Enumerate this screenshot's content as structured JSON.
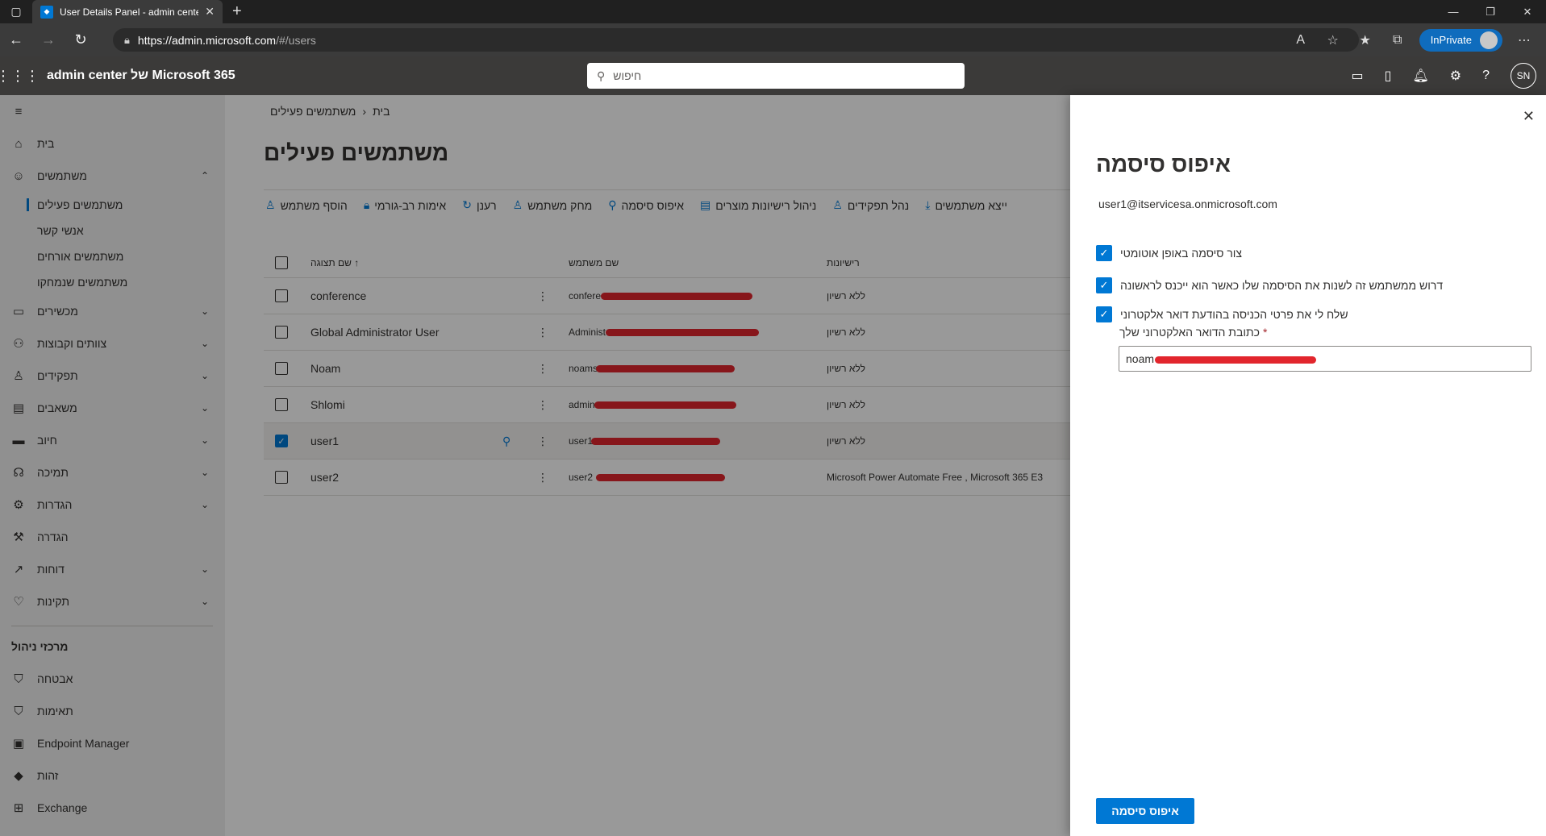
{
  "browser": {
    "tab_title": "User Details Panel - admin cente",
    "url_host": "https://admin.microsoft.com",
    "url_path": "/#/users",
    "inprivate_label": "InPrivate"
  },
  "header": {
    "app_title": "admin center של Microsoft 365",
    "search_placeholder": "חיפוש",
    "avatar_initials": "SN"
  },
  "breadcrumb": {
    "home": "בית",
    "separator": "›",
    "current": "משתמשים פעילים"
  },
  "page_title": "משתמשים פעילים",
  "commands": [
    "הוסף משתמש",
    "אימות רב-גורמי",
    "רענן",
    "מחק משתמש",
    "איפוס סיסמה",
    "ניהול רישיונות מוצרים",
    "נהל תפקידים",
    "ייצא משתמשים"
  ],
  "table": {
    "headers": {
      "display_name": "שם תצוגה",
      "sort_arrow": "↑",
      "username": "שם משתמש",
      "licenses": "רישיונות"
    },
    "rows": [
      {
        "name": "conference",
        "user_prefix": "confere",
        "license": "ללא רשיון"
      },
      {
        "name": "Global Administrator User",
        "user_prefix": "Administ",
        "license": "ללא רשיון"
      },
      {
        "name": "Noam",
        "user_prefix": "noams",
        "license": "ללא רשיון"
      },
      {
        "name": "Shlomi",
        "user_prefix": "admin",
        "license": "ללא רשיון"
      },
      {
        "name": "user1",
        "user_prefix": "user1",
        "license": "ללא רשיון"
      },
      {
        "name": "user2",
        "user_prefix": "user2",
        "license": "Microsoft Power Automate Free , Microsoft 365 E3"
      }
    ]
  },
  "leftnav": {
    "items": [
      {
        "label": "בית",
        "icon": "home-icon"
      },
      {
        "label": "משתמשים",
        "icon": "person-icon"
      },
      {
        "label": "מכשירים",
        "icon": "laptop-icon"
      },
      {
        "label": "צוותים וקבוצות",
        "icon": "group-icon"
      },
      {
        "label": "תפקידים",
        "icon": "role-icon"
      },
      {
        "label": "משאבים",
        "icon": "resource-icon"
      },
      {
        "label": "חיוב",
        "icon": "card-icon"
      },
      {
        "label": "תמיכה",
        "icon": "headset-icon"
      },
      {
        "label": "הגדרות",
        "icon": "gear-icon"
      },
      {
        "label": "הגדרה",
        "icon": "wrench-icon"
      },
      {
        "label": "דוחות",
        "icon": "chart-icon"
      },
      {
        "label": "תקינות",
        "icon": "heart-icon"
      }
    ],
    "sub_items": [
      "משתמשים פעילים",
      "אנשי קשר",
      "משתמשים אורחים",
      "משתמשים שנמחקו"
    ],
    "admin_centers_title": "מרכזי ניהול",
    "admin_centers": [
      {
        "label": "אבטחה",
        "icon": "shield-icon"
      },
      {
        "label": "תאימות",
        "icon": "shield-check-icon"
      },
      {
        "label": "Endpoint Manager",
        "icon": "endpoint-icon"
      },
      {
        "label": "זהות",
        "icon": "diamond-icon"
      },
      {
        "label": "Exchange",
        "icon": "exchange-icon"
      }
    ]
  },
  "panel": {
    "title": "איפוס סיסמה",
    "upn": "user1@itservicesa.onmicrosoft.com",
    "options": [
      "צור סיסמה באופן אוטומטי",
      "דרוש ממשתמש זה לשנות את הסיסמה שלו כאשר הוא ייכנס לראשונה",
      "שלח לי את פרטי הכניסה בהודעת דואר אלקטרוני"
    ],
    "email_label": "כתובת הדואר האלקטרוני שלך",
    "email_required_mark": "*",
    "email_value_prefix": "noam",
    "submit_label": "איפוס סיסמה"
  },
  "colors": {
    "accent": "#0078d4",
    "header_bg": "#3b3a39",
    "redaction": "#e2262d"
  }
}
